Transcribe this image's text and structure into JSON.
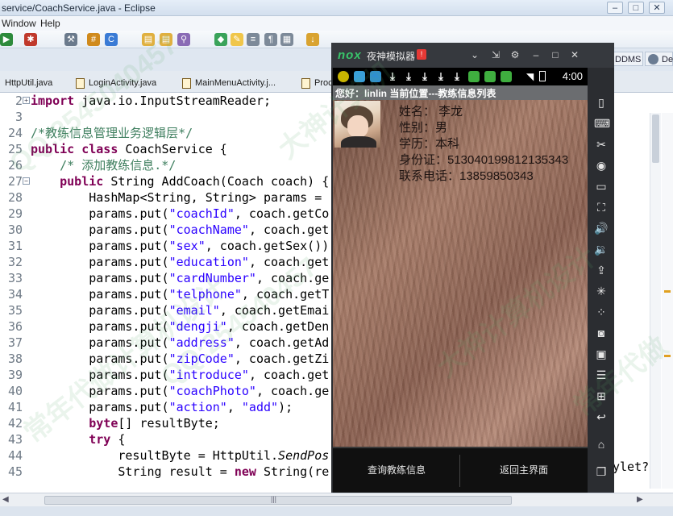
{
  "window": {
    "title": "service/CoachService.java - Eclipse",
    "controls": [
      "–",
      "□",
      "✕"
    ]
  },
  "menu": [
    "Window",
    "Help"
  ],
  "perspectives": [
    "DDMS",
    "De"
  ],
  "tabs": [
    {
      "label": "HttpUtil.java"
    },
    {
      "label": "LoginActivity.java"
    },
    {
      "label": "MainMenuActivity.j..."
    },
    {
      "label": "Proc"
    }
  ],
  "code_lines": [
    {
      "num": "2",
      "marker": "+",
      "tokens": [
        {
          "k": "kw",
          "t": "import"
        },
        {
          "k": "",
          "t": " java.io.InputStreamReader;"
        }
      ]
    },
    {
      "num": "3",
      "tokens": []
    },
    {
      "num": "24",
      "tokens": [
        {
          "k": "cm",
          "t": "/*教练信息管理业务逻辑层*/"
        }
      ]
    },
    {
      "num": "25",
      "tokens": [
        {
          "k": "kw",
          "t": "public class"
        },
        {
          "k": "",
          "t": " CoachService {"
        }
      ]
    },
    {
      "num": "26",
      "tokens": [
        {
          "k": "",
          "t": "    "
        },
        {
          "k": "cm",
          "t": "/* 添加教练信息.*/"
        }
      ]
    },
    {
      "num": "27",
      "marker": "−",
      "tokens": [
        {
          "k": "",
          "t": "    "
        },
        {
          "k": "kw",
          "t": "public"
        },
        {
          "k": "",
          "t": " String AddCoach(Coach coach) {"
        }
      ]
    },
    {
      "num": "28",
      "tokens": [
        {
          "k": "",
          "t": "        HashMap<String, String> params = "
        }
      ]
    },
    {
      "num": "29",
      "tokens": [
        {
          "k": "",
          "t": "        params.put("
        },
        {
          "k": "str",
          "t": "\"coachId\""
        },
        {
          "k": "",
          "t": ", coach.getCo"
        }
      ]
    },
    {
      "num": "30",
      "tokens": [
        {
          "k": "",
          "t": "        params.put("
        },
        {
          "k": "str",
          "t": "\"coachName\""
        },
        {
          "k": "",
          "t": ", coach.get"
        }
      ]
    },
    {
      "num": "31",
      "tokens": [
        {
          "k": "",
          "t": "        params.put("
        },
        {
          "k": "str",
          "t": "\"sex\""
        },
        {
          "k": "",
          "t": ", coach.getSex())"
        }
      ]
    },
    {
      "num": "32",
      "tokens": [
        {
          "k": "",
          "t": "        params.put("
        },
        {
          "k": "str",
          "t": "\"education\""
        },
        {
          "k": "",
          "t": ", coach.get"
        }
      ]
    },
    {
      "num": "33",
      "tokens": [
        {
          "k": "",
          "t": "        params.put("
        },
        {
          "k": "str",
          "t": "\"cardNumber\""
        },
        {
          "k": "",
          "t": ", coach.ge"
        }
      ]
    },
    {
      "num": "34",
      "tokens": [
        {
          "k": "",
          "t": "        params.put("
        },
        {
          "k": "str",
          "t": "\"telphone\""
        },
        {
          "k": "",
          "t": ", coach.getT"
        }
      ]
    },
    {
      "num": "35",
      "tokens": [
        {
          "k": "",
          "t": "        params.put("
        },
        {
          "k": "str",
          "t": "\"email\""
        },
        {
          "k": "",
          "t": ", coach.getEmai"
        }
      ]
    },
    {
      "num": "36",
      "tokens": [
        {
          "k": "",
          "t": "        params.put("
        },
        {
          "k": "str",
          "t": "\"dengji\""
        },
        {
          "k": "",
          "t": ", coach.getDen"
        }
      ]
    },
    {
      "num": "37",
      "tokens": [
        {
          "k": "",
          "t": "        params.put("
        },
        {
          "k": "str",
          "t": "\"address\""
        },
        {
          "k": "",
          "t": ", coach.getAd"
        }
      ]
    },
    {
      "num": "38",
      "tokens": [
        {
          "k": "",
          "t": "        params.put("
        },
        {
          "k": "str",
          "t": "\"zipCode\""
        },
        {
          "k": "",
          "t": ", coach.getZi"
        }
      ]
    },
    {
      "num": "39",
      "tokens": [
        {
          "k": "",
          "t": "        params.put("
        },
        {
          "k": "str",
          "t": "\"introduce\""
        },
        {
          "k": "",
          "t": ", coach.get"
        }
      ]
    },
    {
      "num": "40",
      "tokens": [
        {
          "k": "",
          "t": "        params.put("
        },
        {
          "k": "str",
          "t": "\"coachPhoto\""
        },
        {
          "k": "",
          "t": ", coach.ge"
        }
      ]
    },
    {
      "num": "41",
      "tokens": [
        {
          "k": "",
          "t": "        params.put("
        },
        {
          "k": "str",
          "t": "\"action\""
        },
        {
          "k": "",
          "t": ", "
        },
        {
          "k": "str",
          "t": "\"add\""
        },
        {
          "k": "",
          "t": ");"
        }
      ]
    },
    {
      "num": "42",
      "tokens": [
        {
          "k": "",
          "t": "        "
        },
        {
          "k": "kw",
          "t": "byte"
        },
        {
          "k": "",
          "t": "[] resultByte;"
        }
      ]
    },
    {
      "num": "43",
      "tokens": [
        {
          "k": "",
          "t": "        "
        },
        {
          "k": "kw",
          "t": "try"
        },
        {
          "k": "",
          "t": " {"
        }
      ]
    },
    {
      "num": "44",
      "tokens": [
        {
          "k": "",
          "t": "            resultByte = HttpUtil."
        },
        {
          "k": "it",
          "t": "SendPos"
        }
      ]
    },
    {
      "num": "45",
      "tokens": [
        {
          "k": "",
          "t": "            String result = "
        },
        {
          "k": "kw",
          "t": "new"
        },
        {
          "k": "",
          "t": " String(re"
        }
      ]
    }
  ],
  "code_overflow_right": [
    {
      "row": 16,
      "t": "ylet?"
    },
    {
      "row": 17,
      "t": "ve"
    }
  ],
  "hscroll_label": "|||",
  "emulator": {
    "logo": "nox",
    "name": "夜神模拟器",
    "badge": "!",
    "controls": [
      "⌄",
      "⇲",
      "⚙",
      "–",
      "□",
      "✕"
    ],
    "clock": "4:00",
    "appbar": "您好：linlin  当前位置---教练信息列表",
    "coach": {
      "name": "姓名：  李龙",
      "sex": "性别：男",
      "education": "学历：本科",
      "id_card": "身份证：513040199812135343",
      "phone": "联系电话：13859850343"
    },
    "buttons": {
      "query": "查询教练信息",
      "back": "返回主界面"
    },
    "sidebar_icons": [
      "phone-icon",
      "keyboard-icon",
      "scissors-icon",
      "location-icon",
      "screen-icon",
      "fullscreen-icon",
      "volume-up-icon",
      "volume-down-icon",
      "apk-icon",
      "loading-icon",
      "multi-icon",
      "camera-icon",
      "video-icon",
      "menu-icon",
      "add-icon",
      "back-icon",
      "home-icon",
      "recent-icon"
    ]
  },
  "watermarks": [
    "QQ:2545040457",
    "大神计算机",
    "常年代做计算机设计",
    "QQ:254540457",
    "大神计算机设计",
    "常年代做"
  ],
  "colors": {
    "keyword": "#7f0055",
    "string": "#2a00ff",
    "comment": "#3f7f5f",
    "nox_green": "#39c66b"
  }
}
